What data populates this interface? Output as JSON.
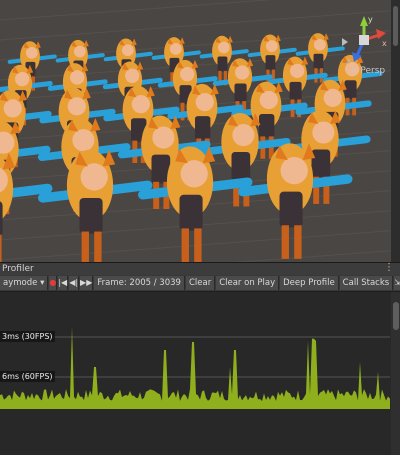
{
  "scene": {
    "view_mode_label": "< Persp",
    "gizmo_axes": {
      "y": "y",
      "x": "x",
      "z": "z"
    },
    "colors": {
      "ground": "#4a4643",
      "hair": "#e8a034",
      "sleeve": "#2aa0d8",
      "outfit": "#3a3236",
      "skin": "#f0b890"
    }
  },
  "profiler": {
    "tab_label": "Profiler",
    "menu_icon": "vertical-ellipsis-icon",
    "toolbar": {
      "mode": "aymode",
      "record_icon": "record-icon",
      "first_frame_icon": "first-frame-icon",
      "prev_frame_icon": "prev-frame-icon",
      "next_frame_icon": "next-frame-icon",
      "last_frame_icon": "last-frame-icon",
      "frame_label": "Frame: 2005 / 3039",
      "clear": "Clear",
      "clear_on_play": "Clear on Play",
      "deep_profile": "Deep Profile",
      "call_stacks": "Call Stacks",
      "save_icon": "save-icon"
    },
    "ref_30fps": "3ms (30FPS)",
    "ref_60fps": "6ms (60FPS)",
    "graph_color": "#8fb01c"
  }
}
